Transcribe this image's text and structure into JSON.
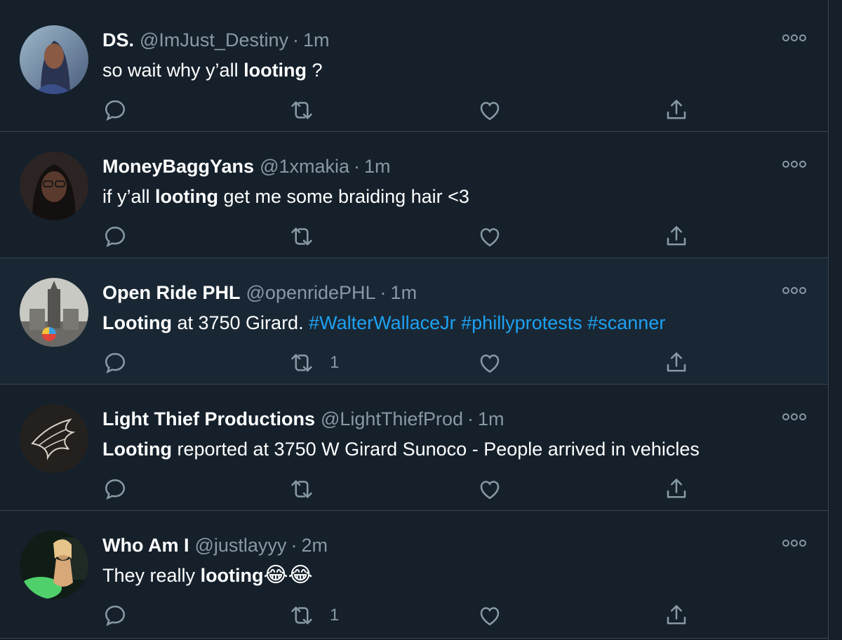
{
  "tweets": [
    {
      "name": "DS.",
      "handle": "@ImJust_Destiny",
      "separator": "·",
      "time": "1m",
      "text_before": "so wait why y’all ",
      "text_bold": "looting",
      "text_after": " ?",
      "retweets": ""
    },
    {
      "name": "MoneyBaggYans",
      "handle": "@1xmakia",
      "separator": "·",
      "time": "1m",
      "text_before": "if y’all ",
      "text_bold": "looting",
      "text_after": " get me some braiding hair <3",
      "retweets": ""
    },
    {
      "name": "Open Ride PHL",
      "handle": "@openridePHL",
      "separator": "·",
      "time": "1m",
      "text_bold": "Looting",
      "text_after": " at 3750 Girard. ",
      "hashtags": [
        "#WalterWallaceJr",
        "#phillyprotests",
        "#scanner"
      ],
      "retweets": "1"
    },
    {
      "name": "Light Thief Productions",
      "handle": "@LightThiefProd",
      "separator": "·",
      "time": "1m",
      "text_bold": "Looting",
      "text_after": " reported at 3750 W Girard Sunoco - People arrived in vehicles",
      "retweets": ""
    },
    {
      "name": "Who Am I",
      "handle": "@justlayyy",
      "separator": "·",
      "time": "2m",
      "text_before": "They really ",
      "text_bold": "looting",
      "emoji": "😂😂",
      "retweets": "1"
    }
  ],
  "colors": {
    "background": "#15202b",
    "hover_background": "#192734",
    "secondary_text": "#8899a6",
    "hashtag": "#1da1f2",
    "divider": "#38444d"
  },
  "icons": [
    "reply-icon",
    "retweet-icon",
    "like-icon",
    "share-icon",
    "more-icon"
  ]
}
